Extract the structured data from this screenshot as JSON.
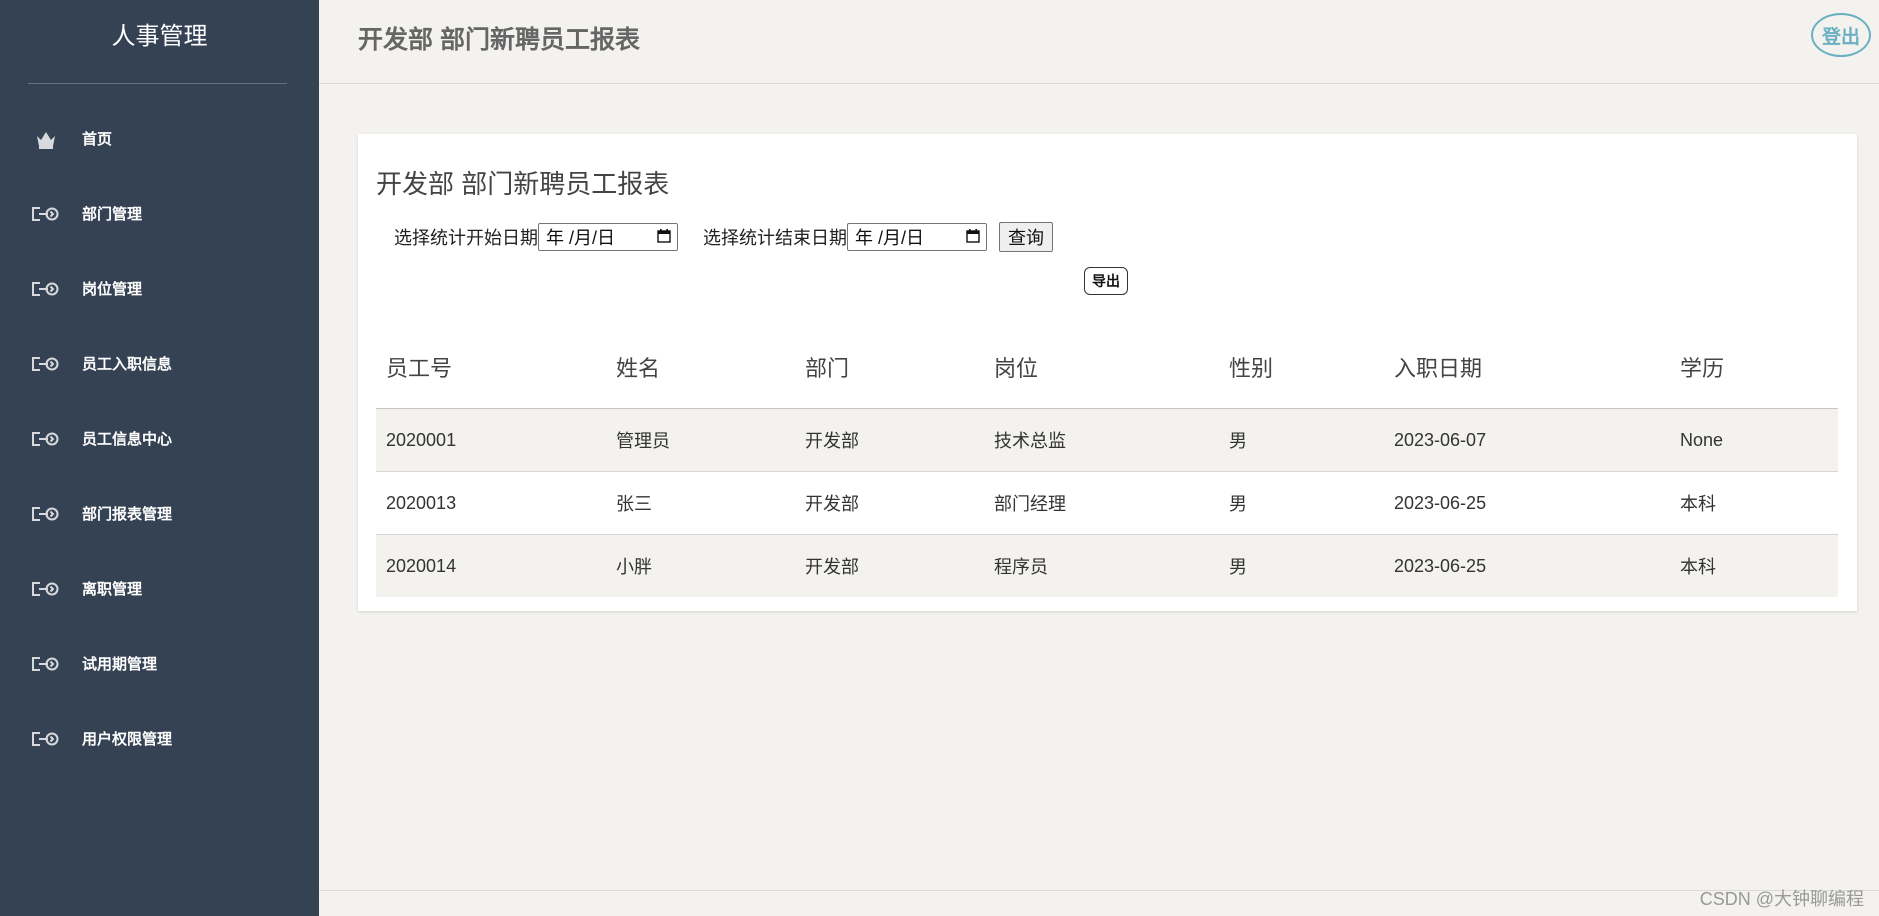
{
  "sidebar": {
    "brand": "人事管理",
    "items": [
      {
        "label": "首页",
        "icon": "crown-icon"
      },
      {
        "label": "部门管理",
        "icon": "arrow-circle-icon"
      },
      {
        "label": "岗位管理",
        "icon": "arrow-circle-icon"
      },
      {
        "label": "员工入职信息",
        "icon": "arrow-circle-icon"
      },
      {
        "label": "员工信息中心",
        "icon": "arrow-circle-icon"
      },
      {
        "label": "部门报表管理",
        "icon": "arrow-circle-icon"
      },
      {
        "label": "离职管理",
        "icon": "arrow-circle-icon"
      },
      {
        "label": "试用期管理",
        "icon": "arrow-circle-icon"
      },
      {
        "label": "用户权限管理",
        "icon": "arrow-circle-icon"
      }
    ]
  },
  "header": {
    "title": "开发部 部门新聘员工报表",
    "logout_label": "登出"
  },
  "report": {
    "title": "开发部 部门新聘员工报表",
    "start_label": "选择统计开始日期",
    "start_placeholder": "年 /月/日",
    "end_label": "选择统计结束日期",
    "end_placeholder": "年 /月/日",
    "query_label": "查询",
    "export_label": "导出",
    "columns": [
      "员工号",
      "姓名",
      "部门",
      "岗位",
      "性别",
      "入职日期",
      "学历"
    ],
    "rows": [
      [
        "2020001",
        "管理员",
        "开发部",
        "技术总监",
        "男",
        "2023-06-07",
        "None"
      ],
      [
        "2020013",
        "张三",
        "开发部",
        "部门经理",
        "男",
        "2023-06-25",
        "本科"
      ],
      [
        "2020014",
        "小胖",
        "开发部",
        "程序员",
        "男",
        "2023-06-25",
        "本科"
      ]
    ]
  },
  "watermark": "CSDN @大钟聊编程",
  "colors": {
    "sidebar_bg": "#354253",
    "page_bg": "#f3f2ef",
    "logout_accent": "#6ab0c2"
  }
}
